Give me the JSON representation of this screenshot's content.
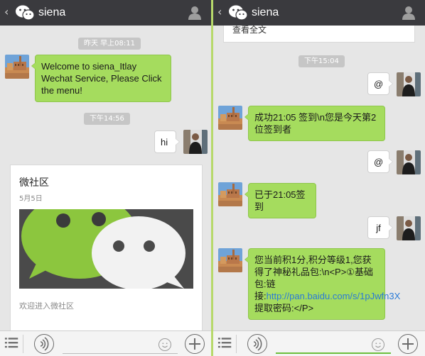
{
  "left": {
    "header": {
      "back": "‹",
      "title": "siena"
    },
    "timestamps": [
      "昨天 早上08:11",
      "下午14:56"
    ],
    "messages": {
      "welcome": "Welcome to siena_Itlay Wechat  Service, Please Click the menu!",
      "hi": "hi"
    },
    "card": {
      "title": "微社区",
      "date": "5月5日",
      "footer": "欢迎进入微社区"
    },
    "input": {
      "value": ""
    }
  },
  "right": {
    "header": {
      "back": "‹",
      "title": "siena"
    },
    "readall": "查看全文",
    "timestamps": [
      "下午15:04"
    ],
    "messages": {
      "at1": "@",
      "signin": "成功21:05 签到\\n您是今天第2位签到者",
      "at2": "@",
      "already": "已于21:05签到",
      "jf": "jf",
      "points_part1": " 您当前积1分,积分等级1,您获得了神秘礼品包:\\n<P>①基础包:链接:",
      "points_link": "http://pan.baidu.com/s/1pJwfn3X",
      "points_part2": " 提取密码:</P>"
    },
    "input": {
      "value": ""
    }
  },
  "colors": {
    "topbar": "#3a3a3e",
    "chat_bg": "#e6e6e6",
    "bubble_green": "#a5dc5e",
    "bubble_white": "#ffffff",
    "link": "#2a7bd6",
    "divider": "#b7d96b"
  },
  "icons": [
    "back-icon",
    "wechat-logo-icon",
    "person-icon",
    "menu-list-icon",
    "voice-icon",
    "emoji-icon",
    "plus-icon"
  ]
}
